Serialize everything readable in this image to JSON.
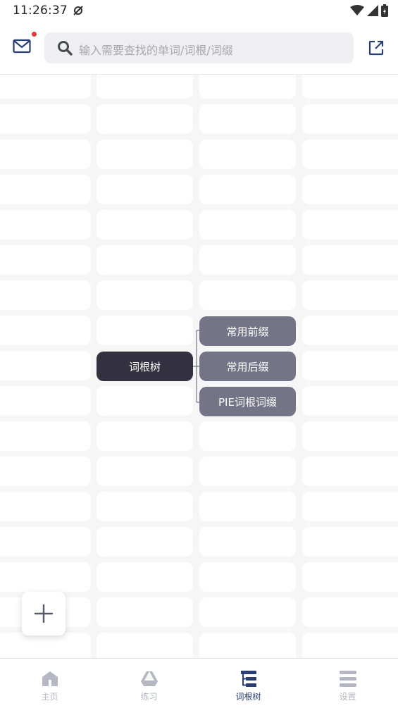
{
  "status_bar": {
    "time": "11:26:37"
  },
  "header": {
    "search_placeholder": "输入需要查找的单词/词根/词缀",
    "has_unread_mail": true
  },
  "tree": {
    "root": "词根树",
    "children": [
      "常用前缀",
      "常用后缀",
      "PIE词根词缀"
    ]
  },
  "fab": {
    "symbol": "+"
  },
  "bottom_nav": {
    "items": [
      {
        "label": "主页",
        "icon": "home-icon",
        "active": false
      },
      {
        "label": "练习",
        "icon": "practice-icon",
        "active": false
      },
      {
        "label": "词根树",
        "icon": "tree-icon",
        "active": true
      },
      {
        "label": "设置",
        "icon": "menu-icon",
        "active": false
      }
    ]
  },
  "colors": {
    "root_node": "#33313f",
    "child_node": "#737587",
    "active_nav": "#2a3e74",
    "inactive_nav": "#b5b8c2",
    "notification_dot": "#e53935"
  }
}
